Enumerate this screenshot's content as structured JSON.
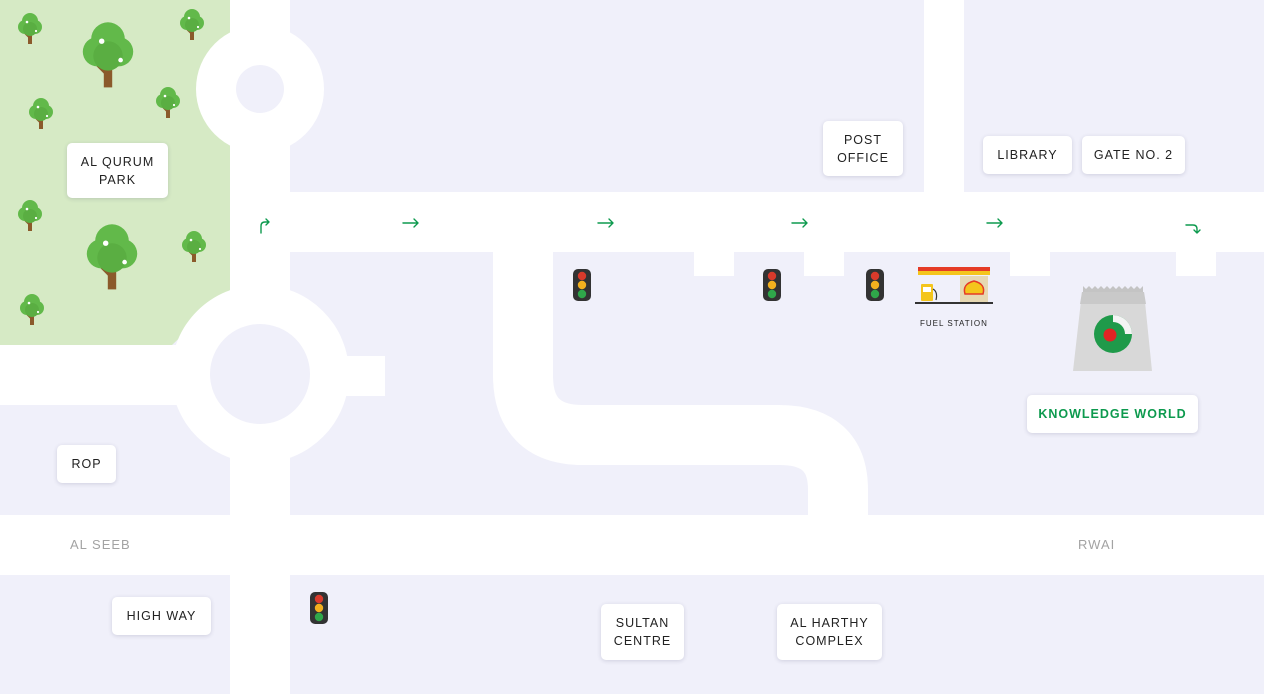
{
  "colors": {
    "background": "#f0f0fa",
    "road": "#ffffff",
    "park": "#d6eac5",
    "accent_green": "#0d9a4e",
    "light_red": "#d93a2b",
    "light_yellow": "#f2b01e",
    "light_green": "#2fa74a"
  },
  "labels": {
    "al_qurum_park": "AL QURUM PARK",
    "post_office": "POST OFFICE",
    "library": "LIBRARY",
    "gate_no_2": "GATE NO. 2",
    "knowledge_world": "KNOWLEDGE WORLD",
    "rop": "ROP",
    "high_way": "HIGH WAY",
    "sultan_centre": "SULTAN CENTRE",
    "al_harthy_complex": "AL HARTHY COMPLEX"
  },
  "road_names": {
    "al_seeb": "AL SEEB",
    "rwai": "RWAI"
  },
  "fuel_station_caption": "FUEL STATION",
  "icons": {
    "tree": "tree-icon",
    "traffic_light": "traffic-light-icon",
    "direction_arrow": "arrow-right-icon",
    "fuel_station": "fuel-station-icon",
    "building": "knowledge-world-building-icon"
  }
}
